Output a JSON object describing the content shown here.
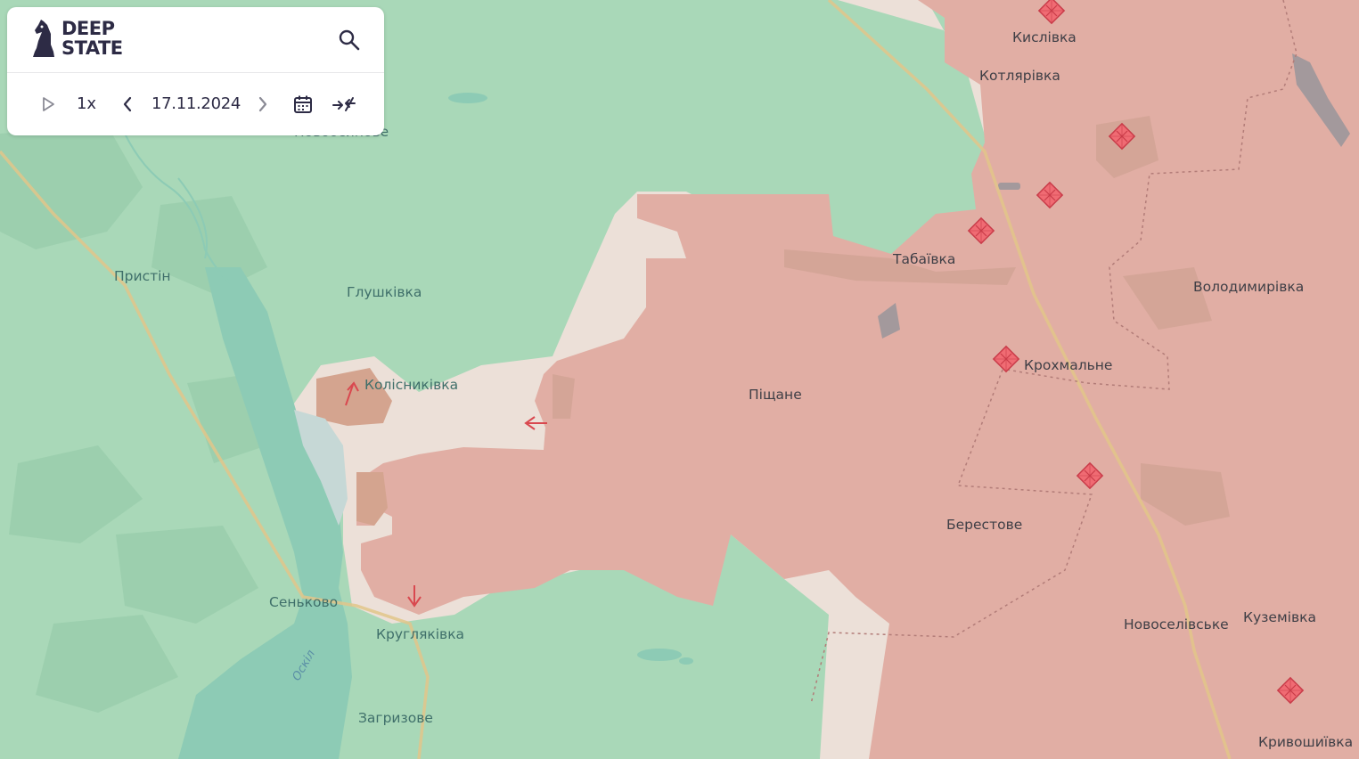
{
  "app": {
    "logo_line1": "DEEP",
    "logo_line2": "STATE"
  },
  "timeline": {
    "play_icon": "play-icon",
    "speed": "1x",
    "prev_icon": "chevron-left-icon",
    "date": "17.11.2024",
    "next_icon": "chevron-right-icon",
    "calendar_icon": "calendar-icon",
    "compare_icon": "compare-arrows-icon"
  },
  "search_icon": "search-icon",
  "colors": {
    "free_territory": "#a9d8b8",
    "occupied": "#e1aea4",
    "grey_zone": "#ece0d8",
    "water": "#8dcbb5",
    "accent": "#e05563"
  },
  "places": {
    "kyslivka": "Кислівка",
    "kotliarivka": "Котлярівка",
    "novoosynove": "Новоосинове",
    "prystin": "Пристін",
    "hlushkivka": "Глушківка",
    "tabaivka": "Табаївка",
    "volodymyrivka": "Володимирівка",
    "kolisnykivka": "Колісниківка",
    "krokhmalne": "Крохмальне",
    "pishchane": "Піщане",
    "berestove": "Берестове",
    "senkove": "Сеньково",
    "krugliakivka": "Кругляківка",
    "novoselivske": "Новоселівське",
    "kuzemivka": "Куземівка",
    "oskil": "Оскіл",
    "zahryzove": "Загризове",
    "kryvoshyivka": "Кривошиївка"
  }
}
